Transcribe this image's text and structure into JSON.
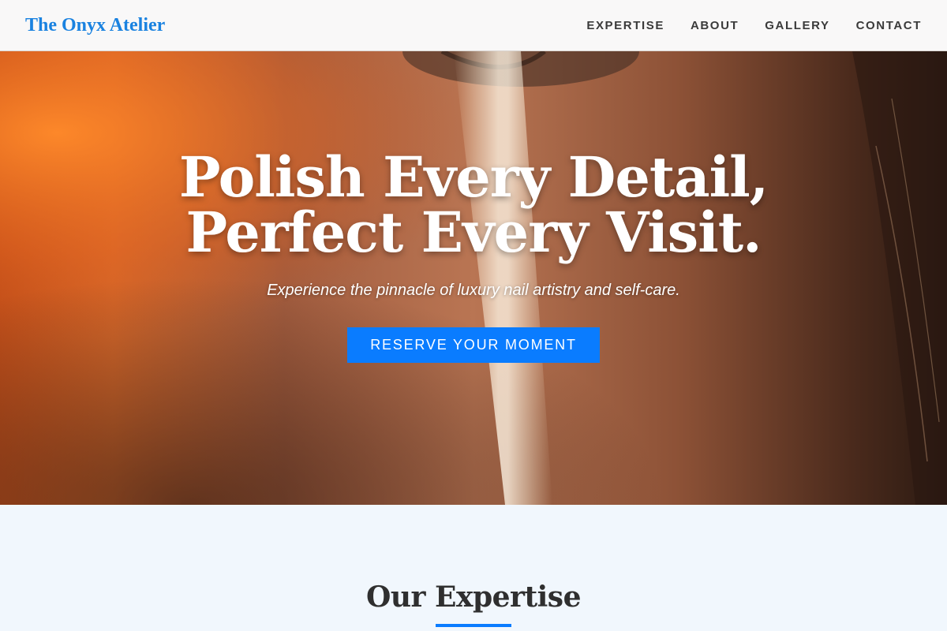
{
  "header": {
    "brand": "The Onyx Atelier",
    "nav": [
      "EXPERTISE",
      "ABOUT",
      "GALLERY",
      "CONTACT"
    ]
  },
  "hero": {
    "title_line1": "Polish Every Detail,",
    "title_line2": "Perfect Every Visit.",
    "subtitle": "Experience the pinnacle of luxury nail artistry and self-care.",
    "cta_label": "RESERVE YOUR MOMENT"
  },
  "expertise": {
    "title": "Our Expertise"
  },
  "colors": {
    "accent": "#0a7cff",
    "brand": "#1a82e0",
    "section_bg": "#f1f7fd"
  }
}
